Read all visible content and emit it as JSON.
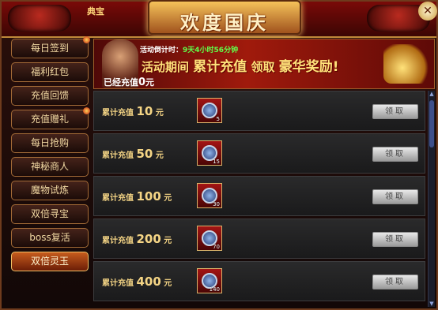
{
  "header": {
    "title": "欢度国庆",
    "small_title": "典宝"
  },
  "sidebar": {
    "items": [
      {
        "label": "每日签到",
        "badge": true
      },
      {
        "label": "福利红包",
        "badge": false
      },
      {
        "label": "充值回馈",
        "badge": false
      },
      {
        "label": "充值赠礼",
        "badge": true
      },
      {
        "label": "每日抢购",
        "badge": false
      },
      {
        "label": "神秘商人",
        "badge": false
      },
      {
        "label": "魔物试炼",
        "badge": false
      },
      {
        "label": "双倍寻宝",
        "badge": false
      },
      {
        "label": "boss复活",
        "badge": false
      },
      {
        "label": "双倍灵玉",
        "badge": false
      }
    ]
  },
  "banner": {
    "countdown_label": "活动倒计时：",
    "countdown_value": "9天4小时56分钟",
    "slogan_part1": "活动期间",
    "slogan_part2": "累计充值",
    "slogan_part3": "领取",
    "slogan_part4": "豪华奖励!",
    "charged_label": "已经充值",
    "charged_amount": "0",
    "charged_unit": "元"
  },
  "rewards": [
    {
      "label": "累计充值",
      "amount": "10",
      "unit": "元",
      "item_count": "5",
      "claim_label": "领取"
    },
    {
      "label": "累计充值",
      "amount": "50",
      "unit": "元",
      "item_count": "15",
      "claim_label": "领取"
    },
    {
      "label": "累计充值",
      "amount": "100",
      "unit": "元",
      "item_count": "30",
      "claim_label": "领取"
    },
    {
      "label": "累计充值",
      "amount": "200",
      "unit": "元",
      "item_count": "70",
      "claim_label": "领取"
    },
    {
      "label": "累计充值",
      "amount": "400",
      "unit": "元",
      "item_count": "140",
      "claim_label": "领取"
    }
  ],
  "icons": {
    "close": "close-icon",
    "reward_item": "jade-orb-icon",
    "scroll_up": "arrow-up-icon",
    "scroll_down": "arrow-down-icon"
  },
  "colors": {
    "accent_gold": "#ffe27a",
    "countdown_green": "#61ff4a",
    "active_tab": "#c75c1d"
  }
}
